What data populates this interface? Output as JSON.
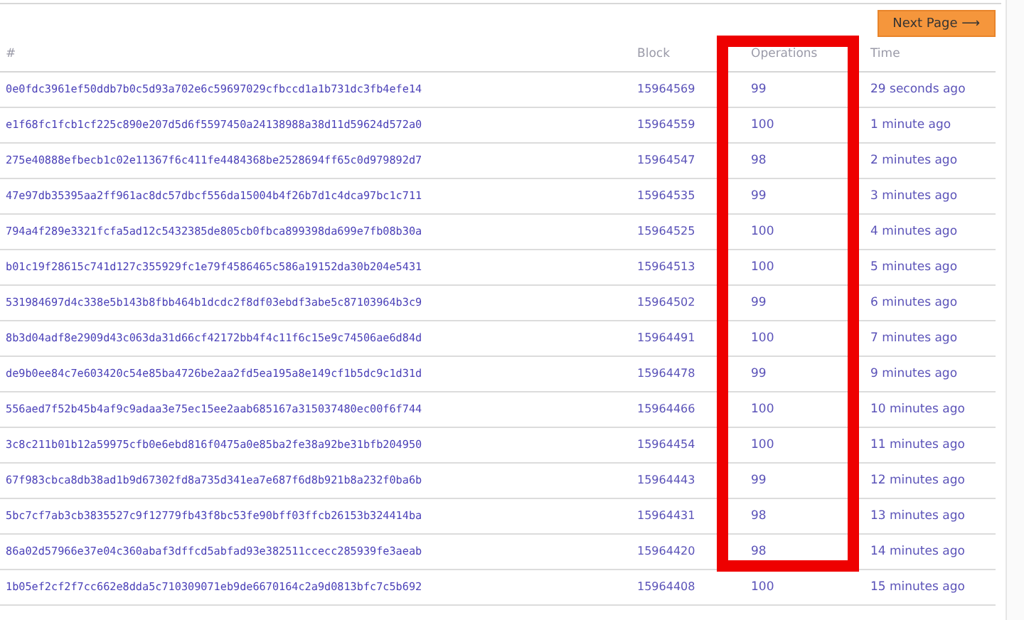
{
  "pager": {
    "next_label": "Next Page ⟶"
  },
  "table": {
    "columns": [
      {
        "label": "#",
        "highlighted": false
      },
      {
        "label": "Block",
        "highlighted": false
      },
      {
        "label": "Operations",
        "highlighted": true
      },
      {
        "label": "Time",
        "highlighted": false
      }
    ],
    "rows": [
      {
        "hash": "0e0fdc3961ef50ddb7b0c5d93a702e6c59697029cfbccd1a1b731dc3fb4efe14",
        "block": "15964569",
        "operations": "99",
        "time": "29 seconds ago"
      },
      {
        "hash": "e1f68fc1fcb1cf225c890e207d5d6f5597450a24138988a38d11d59624d572a0",
        "block": "15964559",
        "operations": "100",
        "time": "1 minute ago"
      },
      {
        "hash": "275e40888efbecb1c02e11367f6c411fe4484368be2528694ff65c0d979892d7",
        "block": "15964547",
        "operations": "98",
        "time": "2 minutes ago"
      },
      {
        "hash": "47e97db35395aa2ff961ac8dc57dbcf556da15004b4f26b7d1c4dca97bc1c711",
        "block": "15964535",
        "operations": "99",
        "time": "3 minutes ago"
      },
      {
        "hash": "794a4f289e3321fcfa5ad12c5432385de805cb0fbca899398da699e7fb08b30a",
        "block": "15964525",
        "operations": "100",
        "time": "4 minutes ago"
      },
      {
        "hash": "b01c19f28615c741d127c355929fc1e79f4586465c586a19152da30b204e5431",
        "block": "15964513",
        "operations": "100",
        "time": "5 minutes ago"
      },
      {
        "hash": "531984697d4c338e5b143b8fbb464b1dcdc2f8df03ebdf3abe5c87103964b3c9",
        "block": "15964502",
        "operations": "99",
        "time": "6 minutes ago"
      },
      {
        "hash": "8b3d04adf8e2909d43c063da31d66cf42172bb4f4c11f6c15e9c74506ae6d84d",
        "block": "15964491",
        "operations": "100",
        "time": "7 minutes ago"
      },
      {
        "hash": "de9b0ee84c7e603420c54e85ba4726be2aa2fd5ea195a8e149cf1b5dc9c1d31d",
        "block": "15964478",
        "operations": "99",
        "time": "9 minutes ago"
      },
      {
        "hash": "556aed7f52b45b4af9c9adaa3e75ec15ee2aab685167a315037480ec00f6f744",
        "block": "15964466",
        "operations": "100",
        "time": "10 minutes ago"
      },
      {
        "hash": "3c8c211b01b12a59975cfb0e6ebd816f0475a0e85ba2fe38a92be31bfb204950",
        "block": "15964454",
        "operations": "100",
        "time": "11 minutes ago"
      },
      {
        "hash": "67f983cbca8db38ad1b9d67302fd8a735d341ea7e687f6d8b921b8a232f0ba6b",
        "block": "15964443",
        "operations": "99",
        "time": "12 minutes ago"
      },
      {
        "hash": "5bc7cf7ab3cb3835527c9f12779fb43f8bc53fe90bff03ffcb26153b324414ba",
        "block": "15964431",
        "operations": "98",
        "time": "13 minutes ago"
      },
      {
        "hash": "86a02d57966e37e04c360abaf3dffcd5abfad93e382511ccecc285939fe3aeab",
        "block": "15964420",
        "operations": "98",
        "time": "14 minutes ago"
      },
      {
        "hash": "1b05ef2cf2f7cc662e8dda5c710309071eb9de6670164c2a9d0813bfc7c5b692",
        "block": "15964408",
        "operations": "100",
        "time": "15 minutes ago"
      }
    ]
  }
}
